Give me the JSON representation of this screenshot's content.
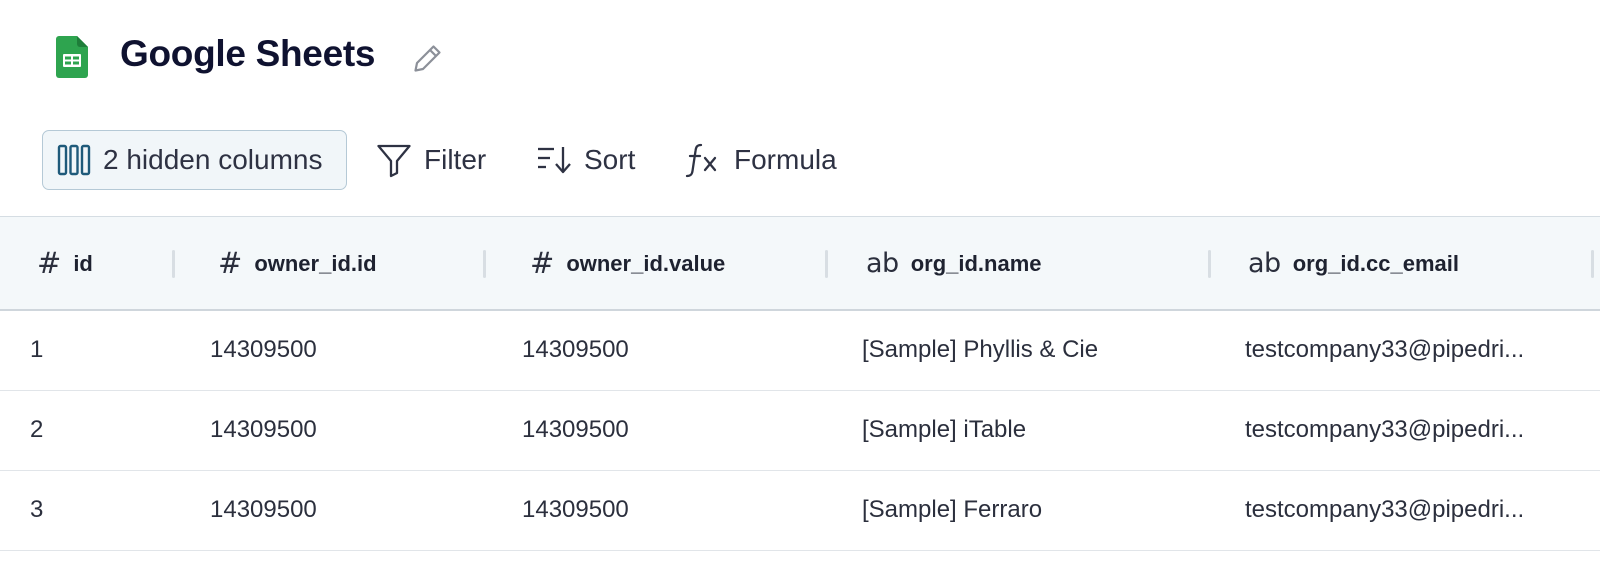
{
  "header": {
    "title": "Google Sheets",
    "app_icon": "google-sheets-icon",
    "edit_icon": "pencil-icon",
    "brand_color": "#34a853"
  },
  "toolbar": {
    "hidden_columns_label": "2 hidden columns",
    "filter_label": "Filter",
    "sort_label": "Sort",
    "formula_label": "Formula",
    "icons": [
      "columns-icon",
      "filter-icon",
      "sort-icon",
      "formula-icon"
    ]
  },
  "table": {
    "columns": [
      {
        "type_icon": "#",
        "type": "number",
        "name": "id"
      },
      {
        "type_icon": "#",
        "type": "number",
        "name": "owner_id.id"
      },
      {
        "type_icon": "#",
        "type": "number",
        "name": "owner_id.value"
      },
      {
        "type_icon": "ab",
        "type": "text",
        "name": "org_id.name"
      },
      {
        "type_icon": "ab",
        "type": "text",
        "name": "org_id.cc_email"
      }
    ],
    "rows": [
      [
        "1",
        "14309500",
        "14309500",
        "[Sample] Phyllis & Cie",
        "testcompany33@pipedri..."
      ],
      [
        "2",
        "14309500",
        "14309500",
        "[Sample] iTable",
        "testcompany33@pipedri..."
      ],
      [
        "3",
        "14309500",
        "14309500",
        "[Sample] Ferraro",
        "testcompany33@pipedri..."
      ]
    ]
  }
}
